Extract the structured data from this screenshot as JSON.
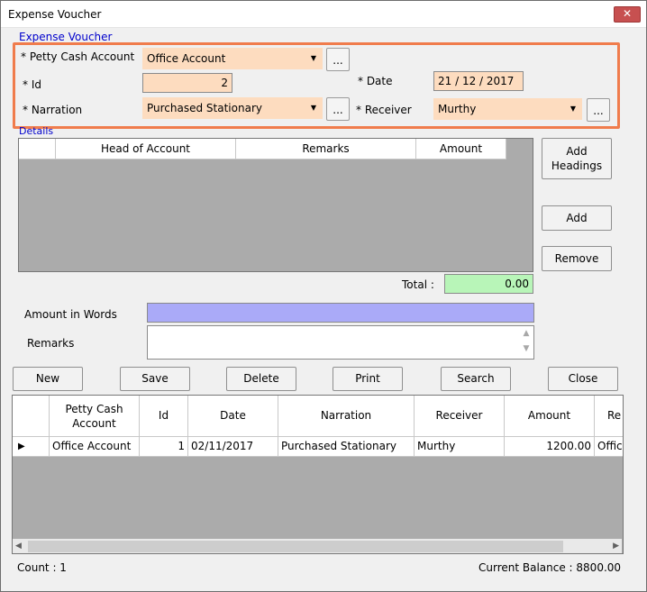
{
  "window": {
    "title": "Expense Voucher",
    "close_glyph": "✕"
  },
  "form": {
    "group_title": "Expense Voucher",
    "petty_cash_label": "* Petty Cash Account",
    "petty_cash_value": "Office Account",
    "id_label": "* Id",
    "id_value": "2",
    "date_label": "* Date",
    "date_value": "21 / 12 / 2017",
    "narration_label": "* Narration",
    "narration_value": "Purchased Stationary",
    "receiver_label": "* Receiver",
    "receiver_value": "Murthy",
    "browse_label": "...",
    "dropdown_glyph": "▼",
    "highlight_color": "#f07c4c"
  },
  "details": {
    "group_title": "Details",
    "columns": [
      "Head of Account",
      "Remarks",
      "Amount"
    ],
    "add_headings_label": "Add Headings",
    "add_label": "Add",
    "remove_label": "Remove",
    "total_label": "Total :",
    "total_value": "0.00",
    "amount_words_label": "Amount in Words",
    "remarks_label": "Remarks",
    "scroll_up": "▲",
    "scroll_down": "▼"
  },
  "actions": {
    "new": "New",
    "save": "Save",
    "delete": "Delete",
    "print": "Print",
    "search": "Search",
    "close": "Close"
  },
  "list": {
    "columns": [
      "Petty Cash Account",
      "Id",
      "Date",
      "Narration",
      "Receiver",
      "Amount",
      "Re"
    ],
    "rows": [
      {
        "indicator": "▶",
        "petty_cash": "Office Account",
        "id": "1",
        "date": "02/11/2017",
        "narration": "Purchased Stationary",
        "receiver": "Murthy",
        "amount": "1200.00",
        "remarks": "Offic"
      }
    ],
    "scroll_left": "◀",
    "scroll_right": "▶"
  },
  "status": {
    "count_label": "Count : 1",
    "balance_label": "Current Balance : 8800.00"
  }
}
